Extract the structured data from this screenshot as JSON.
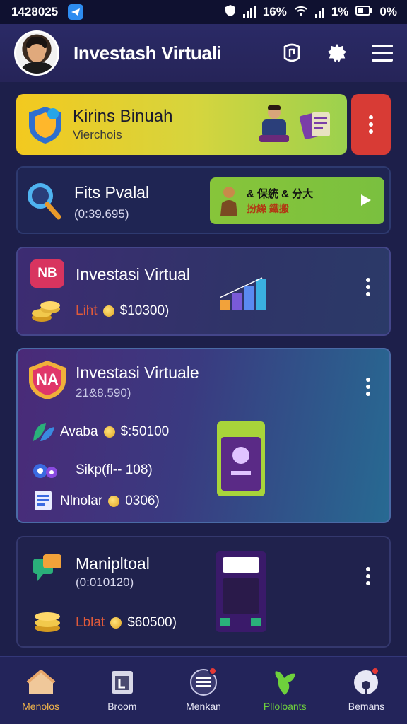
{
  "status_bar": {
    "time": "1428025",
    "signal_text": "16%",
    "battery_text": "1%",
    "extra_text": "0%"
  },
  "app_bar": {
    "title": "Investash Virtuali"
  },
  "cards": [
    {
      "title": "Kirins Binuah",
      "subtitle": "Vierchois"
    },
    {
      "title": "Fits Pvalal",
      "subtitle": "(0:39.695)",
      "cta_line1": "& 保統 & 分大",
      "cta_line2": "扮繰 鐵搬"
    },
    {
      "title": "Investasi Virtual",
      "badge": "NB",
      "tag": "Liht",
      "value": "$10300)"
    },
    {
      "title": "Investasi Virtuale",
      "badge": "NA",
      "subtitle": "21&8.590)",
      "rows": [
        {
          "label": "Avaba",
          "value": "$:50100"
        },
        {
          "label": "Sikp(fl-- 108)",
          "value": ""
        },
        {
          "label": "Nlnolar",
          "value": "0306)"
        }
      ]
    },
    {
      "title": "Manipltoal",
      "subtitle": "(0:010120)",
      "tag": "Lblat",
      "value": "$60500)"
    }
  ],
  "bottom_nav": [
    {
      "label": "Menolos",
      "icon": "home-icon"
    },
    {
      "label": "Broom",
      "icon": "document-icon"
    },
    {
      "label": "Menkan",
      "icon": "list-icon"
    },
    {
      "label": "Plloloants",
      "icon": "plant-icon",
      "active": true
    },
    {
      "label": "Bemans",
      "icon": "globe-icon"
    }
  ],
  "colors": {
    "background": "#1d1f4a",
    "accent_green": "#6ed13c",
    "accent_red": "#d83b35",
    "accent_yellow": "#f3c91f"
  }
}
